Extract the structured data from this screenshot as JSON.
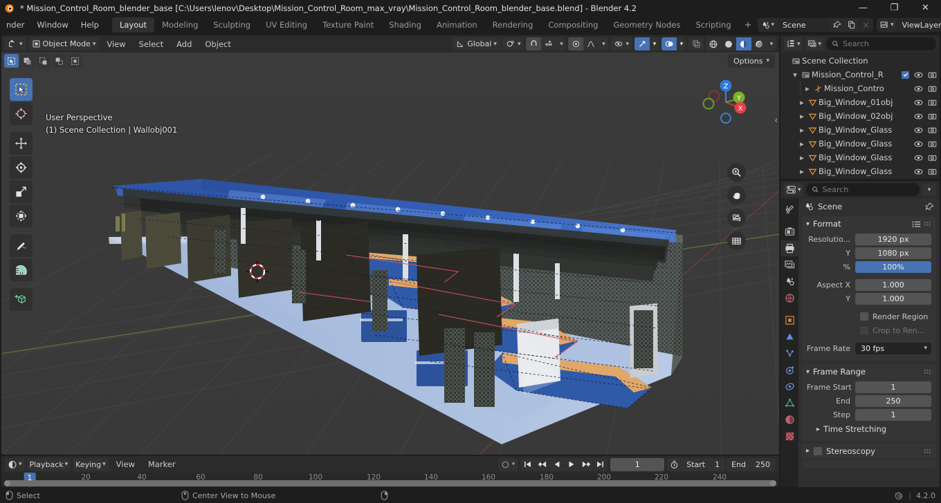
{
  "window": {
    "title": "* Mission_Control_Room_blender_base [C:\\Users\\lenov\\Desktop\\Mission_Control_Room_max_vray\\Mission_Control_Room_blender_base.blend] - Blender 4.2",
    "minimize": "—",
    "maximize": "❐",
    "close": "✕"
  },
  "topbar": {
    "menus": [
      "nder",
      "Window",
      "Help"
    ],
    "tabs": [
      {
        "label": "Layout",
        "active": true
      },
      {
        "label": "Modeling",
        "active": false
      },
      {
        "label": "Sculpting",
        "active": false
      },
      {
        "label": "UV Editing",
        "active": false
      },
      {
        "label": "Texture Paint",
        "active": false
      },
      {
        "label": "Shading",
        "active": false
      },
      {
        "label": "Animation",
        "active": false
      },
      {
        "label": "Rendering",
        "active": false
      },
      {
        "label": "Compositing",
        "active": false
      },
      {
        "label": "Geometry Nodes",
        "active": false
      },
      {
        "label": "Scripting",
        "active": false
      }
    ],
    "add_tab": "+",
    "scene_name": "Scene",
    "viewlayer_name": "ViewLayer"
  },
  "viewport": {
    "mode": "Object Mode",
    "menus": [
      "View",
      "Select",
      "Add",
      "Object"
    ],
    "orientation": "Global",
    "options_label": "Options",
    "info_line1": "User Perspective",
    "info_line2": "(1) Scene Collection | Wallobj001",
    "gizmo": {
      "z": "Z",
      "y": "Y",
      "x": "X"
    }
  },
  "outliner": {
    "search_placeholder": "Search",
    "rows": [
      {
        "label": "Scene Collection",
        "depth": 0,
        "icon": "collection-icon",
        "chevron": "",
        "checkbox": false,
        "eye": false,
        "camera": false
      },
      {
        "label": "Mission_Control_R",
        "depth": 1,
        "icon": "collection-icon",
        "chevron": "down",
        "checkbox": true,
        "eye": true,
        "camera": true
      },
      {
        "label": "Mission_Contro",
        "depth": 2,
        "icon": "empty-axes-icon",
        "chevron": "right",
        "checkbox": false,
        "eye": true,
        "camera": true
      },
      {
        "label": "Big_Window_01obj",
        "depth": 2,
        "icon": "mesh-icon",
        "chevron": "right",
        "checkbox": false,
        "eye": true,
        "camera": true
      },
      {
        "label": "Big_Window_02obj",
        "depth": 2,
        "icon": "mesh-icon",
        "chevron": "right",
        "checkbox": false,
        "eye": true,
        "camera": true
      },
      {
        "label": "Big_Window_Glass",
        "depth": 2,
        "icon": "mesh-icon",
        "chevron": "right",
        "checkbox": false,
        "eye": true,
        "camera": true
      },
      {
        "label": "Big_Window_Glass",
        "depth": 2,
        "icon": "mesh-icon",
        "chevron": "right",
        "checkbox": false,
        "eye": true,
        "camera": true
      },
      {
        "label": "Big_Window_Glass",
        "depth": 2,
        "icon": "mesh-icon",
        "chevron": "right",
        "checkbox": false,
        "eye": true,
        "camera": true
      },
      {
        "label": "Big_Window_Glass",
        "depth": 2,
        "icon": "mesh-icon",
        "chevron": "right",
        "checkbox": false,
        "eye": true,
        "camera": true
      }
    ]
  },
  "properties": {
    "search_placeholder": "Search",
    "breadcrumb": "Scene",
    "format": {
      "title": "Format",
      "resolution_x_label": "Resolutio...",
      "resolution_x_value": "1920 px",
      "resolution_y_label": "Y",
      "resolution_y_value": "1080 px",
      "percent_label": "%",
      "percent_value": "100%",
      "aspect_x_label": "Aspect X",
      "aspect_x_value": "1.000",
      "aspect_y_label": "Y",
      "aspect_y_value": "1.000",
      "render_region_label": "Render Region",
      "crop_label": "Crop to Ren...",
      "frame_rate_label": "Frame Rate",
      "frame_rate_value": "30 fps"
    },
    "frame_range": {
      "title": "Frame Range",
      "start_label": "Frame Start",
      "start_value": "1",
      "end_label": "End",
      "end_value": "250",
      "step_label": "Step",
      "step_value": "1",
      "time_stretching": "Time Stretching"
    },
    "stereoscopy": "Stereoscopy"
  },
  "timeline": {
    "menus": [
      "View",
      "Marker"
    ],
    "playback_label": "Playback",
    "keying_label": "Keying",
    "current_frame": "1",
    "start_label": "Start",
    "start_value": "1",
    "end_label": "End",
    "end_value": "250",
    "playhead_frame": "1",
    "ticks": [
      "20",
      "40",
      "60",
      "80",
      "100",
      "120",
      "140",
      "160",
      "180",
      "200",
      "220",
      "240"
    ]
  },
  "statusbar": {
    "items": [
      "Select",
      "Center View to Mouse"
    ],
    "version": "4.2.0",
    "separator": "|"
  }
}
